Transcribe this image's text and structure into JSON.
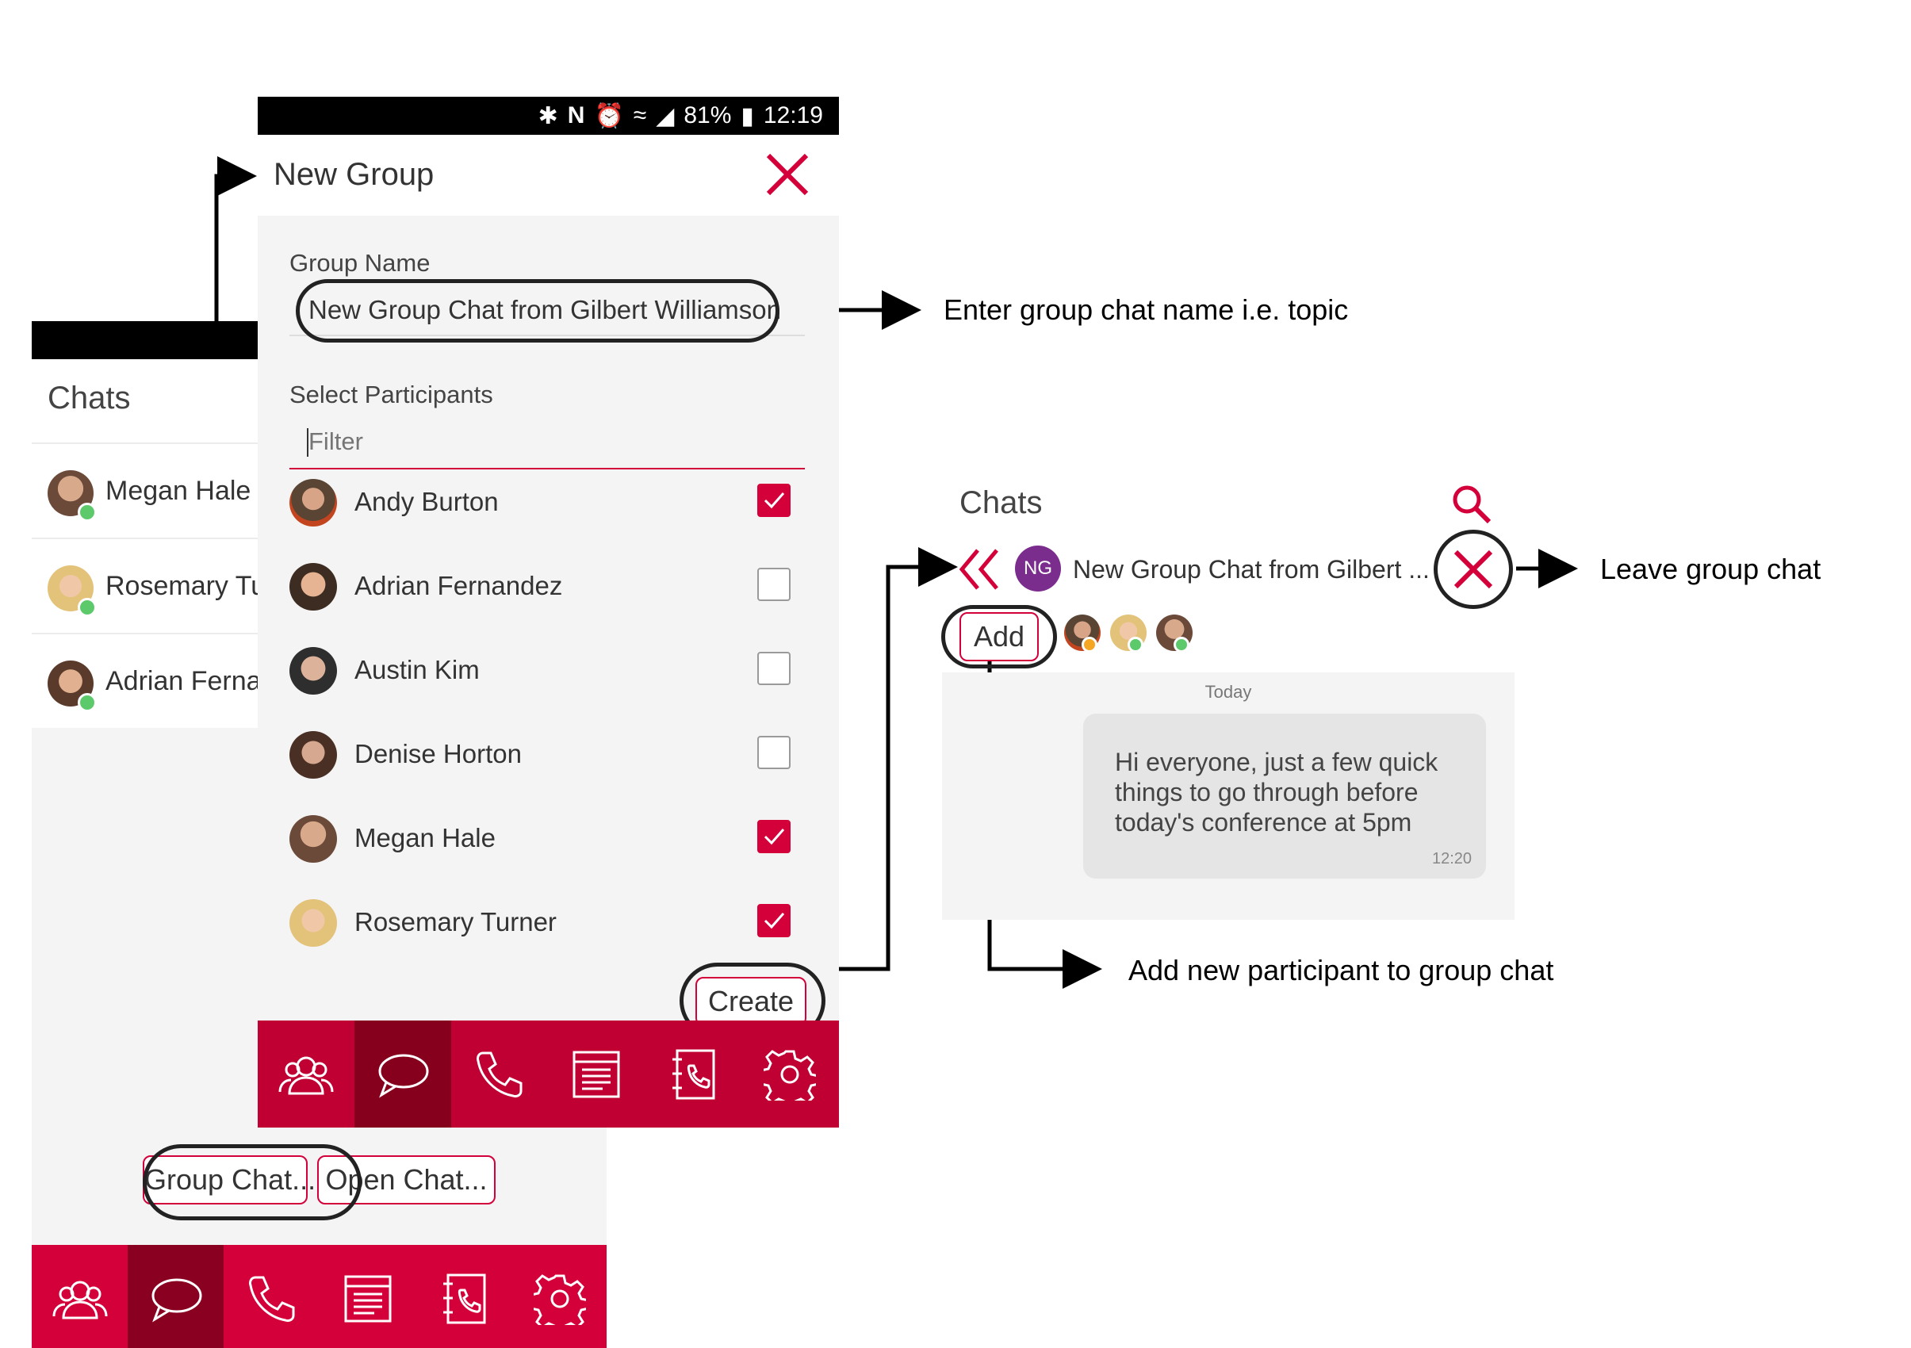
{
  "colors": {
    "brand": "#d4003a",
    "brand_dark": "#8a0020",
    "online": "#5cc96b",
    "away": "#f5a623",
    "ng_avatar": "#7b2d8e"
  },
  "back_screen": {
    "title": "Chats",
    "chats": [
      {
        "name": "Megan Hale",
        "status": "online"
      },
      {
        "name": "Rosemary Tu",
        "status": "online"
      },
      {
        "name": "Adrian Fernar",
        "status": "online"
      }
    ],
    "actions": {
      "group_chat": "Group Chat...",
      "open_chat": "Open Chat..."
    },
    "nav": [
      "contacts-icon",
      "chat-bubble-icon",
      "phone-icon",
      "notes-icon",
      "phonebook-icon",
      "settings-icon"
    ]
  },
  "front_screen": {
    "status_bar": {
      "battery": "81%",
      "time": "12:19"
    },
    "title": "New Group",
    "group_name_label": "Group Name",
    "group_name_value": "New Group Chat from Gilbert Williamson",
    "select_participants_label": "Select Participants",
    "filter_placeholder": "Filter",
    "participants": [
      {
        "name": "Andy Burton",
        "checked": true
      },
      {
        "name": "Adrian Fernandez",
        "checked": false
      },
      {
        "name": "Austin Kim",
        "checked": false
      },
      {
        "name": "Denise Horton",
        "checked": false
      },
      {
        "name": "Megan Hale",
        "checked": true
      },
      {
        "name": "Rosemary Turner",
        "checked": true
      }
    ],
    "create_label": "Create",
    "nav": [
      "contacts-icon",
      "chat-bubble-icon",
      "phone-icon",
      "notes-icon",
      "phonebook-icon",
      "settings-icon"
    ]
  },
  "chat_screen": {
    "title": "Chats",
    "avatar_initials": "NG",
    "chat_name": "New Group Chat from Gilbert ...",
    "add_label": "Add",
    "day_label": "Today",
    "message": {
      "text": "Hi everyone, just a few quick things to go through before today's conference at 5pm",
      "time": "12:20"
    }
  },
  "callouts": {
    "group_name": "Enter group chat name i.e. topic",
    "leave": "Leave group chat",
    "add": "Add new participant to group chat"
  }
}
